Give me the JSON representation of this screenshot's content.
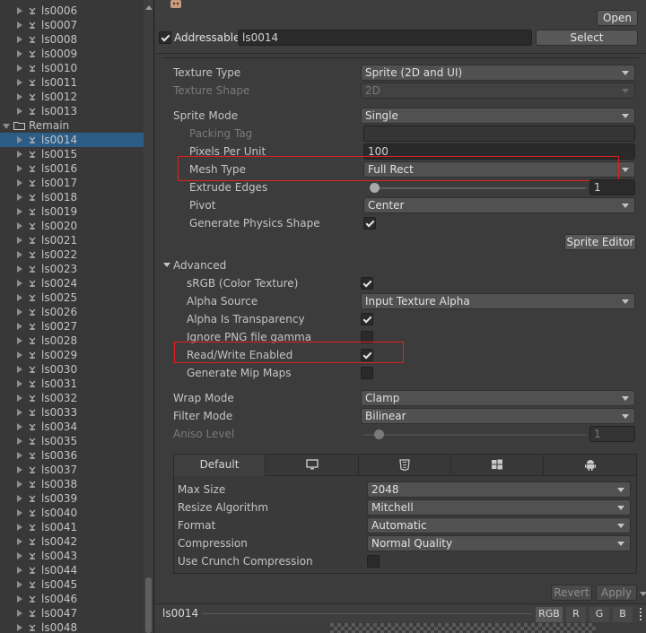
{
  "tree": {
    "items": [
      {
        "label": "ls0006",
        "kind": "sprite",
        "depth": 1
      },
      {
        "label": "ls0007",
        "kind": "sprite",
        "depth": 1
      },
      {
        "label": "ls0008",
        "kind": "sprite",
        "depth": 1
      },
      {
        "label": "ls0009",
        "kind": "sprite",
        "depth": 1
      },
      {
        "label": "ls0010",
        "kind": "sprite",
        "depth": 1
      },
      {
        "label": "ls0011",
        "kind": "sprite",
        "depth": 1
      },
      {
        "label": "ls0012",
        "kind": "sprite",
        "depth": 1
      },
      {
        "label": "ls0013",
        "kind": "sprite",
        "depth": 1
      },
      {
        "label": "Remain",
        "kind": "folder",
        "depth": 0
      },
      {
        "label": "ls0014",
        "kind": "sprite",
        "depth": 1,
        "selected": true
      },
      {
        "label": "ls0015",
        "kind": "sprite",
        "depth": 1
      },
      {
        "label": "ls0016",
        "kind": "sprite",
        "depth": 1
      },
      {
        "label": "ls0017",
        "kind": "sprite",
        "depth": 1
      },
      {
        "label": "ls0018",
        "kind": "sprite",
        "depth": 1
      },
      {
        "label": "ls0019",
        "kind": "sprite",
        "depth": 1
      },
      {
        "label": "ls0020",
        "kind": "sprite",
        "depth": 1
      },
      {
        "label": "ls0021",
        "kind": "sprite",
        "depth": 1
      },
      {
        "label": "ls0022",
        "kind": "sprite",
        "depth": 1
      },
      {
        "label": "ls0023",
        "kind": "sprite",
        "depth": 1
      },
      {
        "label": "ls0024",
        "kind": "sprite",
        "depth": 1
      },
      {
        "label": "ls0025",
        "kind": "sprite",
        "depth": 1
      },
      {
        "label": "ls0026",
        "kind": "sprite",
        "depth": 1
      },
      {
        "label": "ls0027",
        "kind": "sprite",
        "depth": 1
      },
      {
        "label": "ls0028",
        "kind": "sprite",
        "depth": 1
      },
      {
        "label": "ls0029",
        "kind": "sprite",
        "depth": 1
      },
      {
        "label": "ls0030",
        "kind": "sprite",
        "depth": 1
      },
      {
        "label": "ls0031",
        "kind": "sprite",
        "depth": 1
      },
      {
        "label": "ls0032",
        "kind": "sprite",
        "depth": 1
      },
      {
        "label": "ls0033",
        "kind": "sprite",
        "depth": 1
      },
      {
        "label": "ls0034",
        "kind": "sprite",
        "depth": 1
      },
      {
        "label": "ls0035",
        "kind": "sprite",
        "depth": 1
      },
      {
        "label": "ls0036",
        "kind": "sprite",
        "depth": 1
      },
      {
        "label": "ls0037",
        "kind": "sprite",
        "depth": 1
      },
      {
        "label": "ls0038",
        "kind": "sprite",
        "depth": 1
      },
      {
        "label": "ls0039",
        "kind": "sprite",
        "depth": 1
      },
      {
        "label": "ls0040",
        "kind": "sprite",
        "depth": 1
      },
      {
        "label": "ls0041",
        "kind": "sprite",
        "depth": 1
      },
      {
        "label": "ls0042",
        "kind": "sprite",
        "depth": 1
      },
      {
        "label": "ls0043",
        "kind": "sprite",
        "depth": 1
      },
      {
        "label": "ls0044",
        "kind": "sprite",
        "depth": 1
      },
      {
        "label": "ls0045",
        "kind": "sprite",
        "depth": 1
      },
      {
        "label": "ls0046",
        "kind": "sprite",
        "depth": 1
      },
      {
        "label": "ls0047",
        "kind": "sprite",
        "depth": 1
      },
      {
        "label": "ls0048",
        "kind": "sprite",
        "depth": 1
      }
    ]
  },
  "header": {
    "open_label": "Open",
    "addressable_label": "Addressable",
    "addressable_checked": true,
    "address_value": "ls0014",
    "select_label": "Select"
  },
  "settings": {
    "texture_type_label": "Texture Type",
    "texture_type_value": "Sprite (2D and UI)",
    "texture_shape_label": "Texture Shape",
    "texture_shape_value": "2D",
    "sprite_mode_label": "Sprite Mode",
    "sprite_mode_value": "Single",
    "packing_tag_label": "Packing Tag",
    "packing_tag_value": "",
    "ppu_label": "Pixels Per Unit",
    "ppu_value": "100",
    "mesh_type_label": "Mesh Type",
    "mesh_type_value": "Full Rect",
    "extrude_label": "Extrude Edges",
    "extrude_value": "1",
    "pivot_label": "Pivot",
    "pivot_value": "Center",
    "physics_label": "Generate Physics Shape",
    "physics_checked": true,
    "sprite_editor_label": "Sprite Editor",
    "advanced_label": "Advanced",
    "srgb_label": "sRGB (Color Texture)",
    "srgb_checked": true,
    "alpha_source_label": "Alpha Source",
    "alpha_source_value": "Input Texture Alpha",
    "alpha_transparency_label": "Alpha Is Transparency",
    "alpha_transparency_checked": true,
    "ignore_gamma_label": "Ignore PNG file gamma",
    "ignore_gamma_checked": false,
    "read_write_label": "Read/Write Enabled",
    "read_write_checked": true,
    "mipmaps_label": "Generate Mip Maps",
    "mipmaps_checked": false,
    "wrap_label": "Wrap Mode",
    "wrap_value": "Clamp",
    "filter_label": "Filter Mode",
    "filter_value": "Bilinear",
    "aniso_label": "Aniso Level",
    "aniso_value": "1"
  },
  "platform": {
    "default_tab_label": "Default",
    "tabs": [
      "default",
      "desktop-icon",
      "html5-icon",
      "windows-icon",
      "android-icon"
    ],
    "max_size_label": "Max Size",
    "max_size_value": "2048",
    "resize_label": "Resize Algorithm",
    "resize_value": "Mitchell",
    "format_label": "Format",
    "format_value": "Automatic",
    "compression_label": "Compression",
    "compression_value": "Normal Quality",
    "crunch_label": "Use Crunch Compression",
    "crunch_checked": false
  },
  "footer": {
    "revert_label": "Revert",
    "apply_label": "Apply"
  },
  "preview": {
    "name": "ls0014",
    "channels": [
      "RGB",
      "R",
      "G",
      "B"
    ]
  },
  "colors": {
    "selection": "#2c5d87",
    "highlight_box": "#e02020"
  }
}
